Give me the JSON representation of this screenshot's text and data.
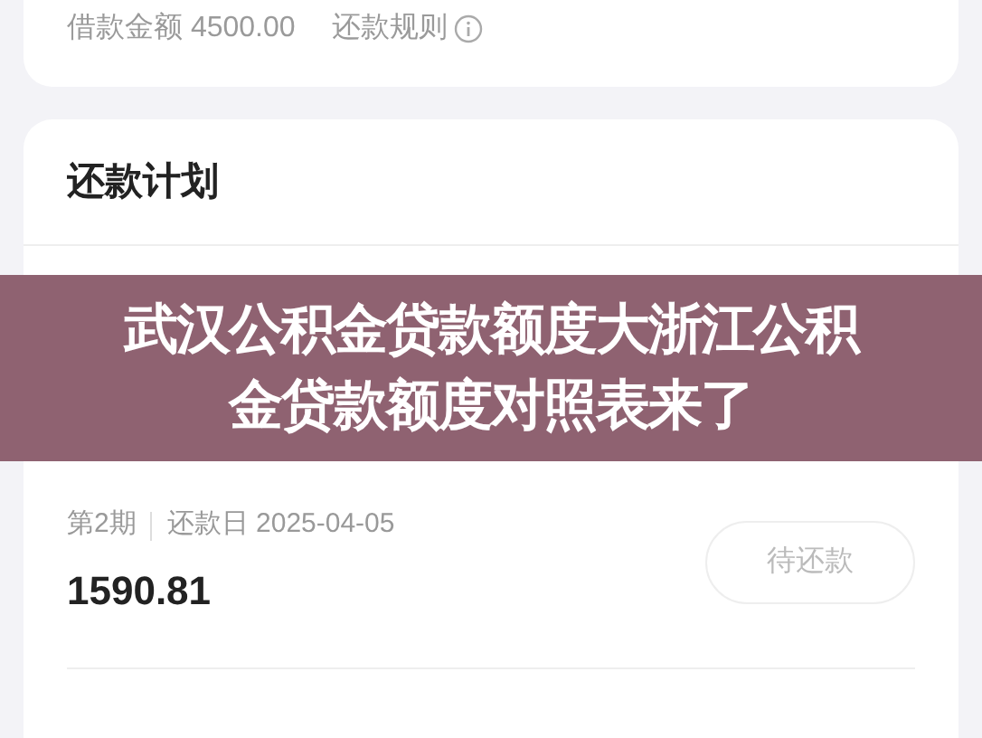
{
  "loan_card": {
    "amount_label": "借款金额 4500.00",
    "rules_link": "还款规则"
  },
  "plan": {
    "title": "还款计划",
    "installments": [
      {
        "period": "第2期",
        "date": "还款日 2025-04-05",
        "amount": "1590.81",
        "status": "待还款"
      }
    ]
  },
  "banner": {
    "title": "武汉公积金贷款额度大浙江公积金贷款额度对照表来了"
  }
}
